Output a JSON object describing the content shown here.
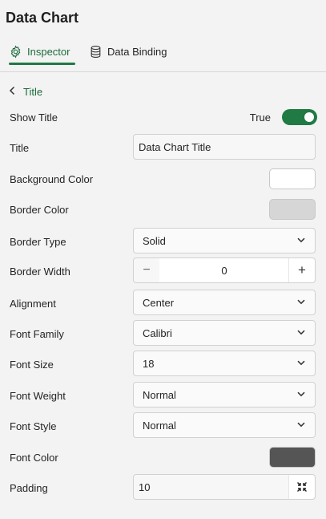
{
  "app": {
    "title": "Data Chart"
  },
  "tabs": [
    {
      "label": "Inspector",
      "icon": "gear-icon",
      "active": true
    },
    {
      "label": "Data Binding",
      "icon": "database-icon",
      "active": false
    }
  ],
  "breadcrumb": {
    "label": "Title",
    "icon": "chevron-left-icon"
  },
  "properties": {
    "show_title": {
      "label": "Show Title",
      "value": "True"
    },
    "title": {
      "label": "Title",
      "value": "Data Chart Title"
    },
    "background_color": {
      "label": "Background Color",
      "color": "#ffffff"
    },
    "border_color": {
      "label": "Border Color",
      "color": "#d6d6d6"
    },
    "border_type": {
      "label": "Border Type",
      "value": "Solid"
    },
    "border_width": {
      "label": "Border Width",
      "value": "0",
      "minus": "−",
      "plus": "+"
    },
    "alignment": {
      "label": "Alignment",
      "value": "Center"
    },
    "font_family": {
      "label": "Font Family",
      "value": "Calibri"
    },
    "font_size": {
      "label": "Font Size",
      "value": "18"
    },
    "font_weight": {
      "label": "Font Weight",
      "value": "Normal"
    },
    "font_style": {
      "label": "Font Style",
      "value": "Normal"
    },
    "font_color": {
      "label": "Font Color",
      "color": "#555555"
    },
    "padding": {
      "label": "Padding",
      "value": "10"
    }
  },
  "colors": {
    "accent": "#1f7a44"
  }
}
